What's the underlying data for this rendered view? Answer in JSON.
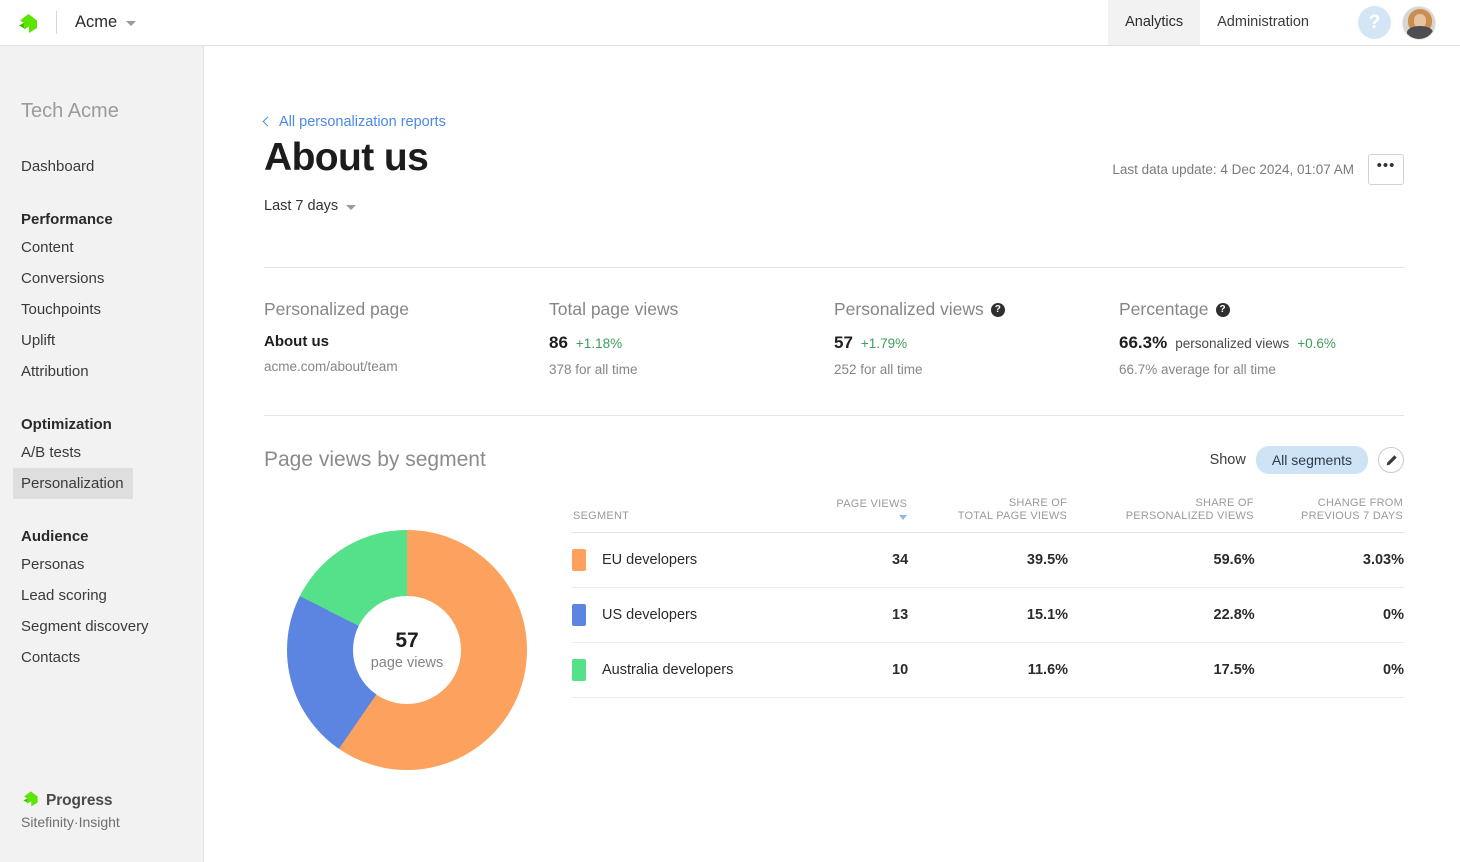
{
  "topbar": {
    "logo_icon": "progress-logo-icon",
    "org_name": "Acme",
    "org_caret_icon": "chevron-down-icon",
    "tabs": [
      {
        "label": "Analytics",
        "active": true
      },
      {
        "label": "Administration",
        "active": false
      }
    ],
    "help_icon": "question-mark-icon",
    "help_glyph": "?",
    "avatar_icon": "user-avatar"
  },
  "sidebar": {
    "org_title": "Tech Acme",
    "items": [
      {
        "label": "Dashboard",
        "type": "link",
        "selected": false
      },
      {
        "label": "Performance",
        "type": "group"
      },
      {
        "label": "Content",
        "type": "link",
        "selected": false
      },
      {
        "label": "Conversions",
        "type": "link",
        "selected": false
      },
      {
        "label": "Touchpoints",
        "type": "link",
        "selected": false
      },
      {
        "label": "Uplift",
        "type": "link",
        "selected": false
      },
      {
        "label": "Attribution",
        "type": "link",
        "selected": false
      },
      {
        "label": "Optimization",
        "type": "group"
      },
      {
        "label": "A/B tests",
        "type": "link",
        "selected": false
      },
      {
        "label": "Personalization",
        "type": "link",
        "selected": true
      },
      {
        "label": "Audience",
        "type": "group"
      },
      {
        "label": "Personas",
        "type": "link",
        "selected": false
      },
      {
        "label": "Lead scoring",
        "type": "link",
        "selected": false
      },
      {
        "label": "Segment discovery",
        "type": "link",
        "selected": false
      },
      {
        "label": "Contacts",
        "type": "link",
        "selected": false
      }
    ],
    "footer": {
      "logo_icon": "progress-logo-icon",
      "product_name": "Progress",
      "product_sub": "Sitefinity·Insight"
    }
  },
  "header": {
    "breadcrumb_icon": "chevron-left-icon",
    "breadcrumb_label": "All personalization reports",
    "title": "About us",
    "date_range": "Last 7 days",
    "date_range_icon": "chevron-down-icon",
    "last_update": "Last data update: 4 Dec 2024, 01:07 AM",
    "more_icon": "ellipsis-icon",
    "more_glyph": "•••"
  },
  "kpis": [
    {
      "label": "Personalized page",
      "has_info": false,
      "value": "About us",
      "value_style": "strong",
      "delta": "",
      "inline_note": "",
      "sub": "acme.com/about/team"
    },
    {
      "label": "Total page views",
      "has_info": false,
      "value": "86",
      "value_style": "number",
      "delta": "+1.18%",
      "inline_note": "",
      "sub": "378 for all time"
    },
    {
      "label": "Personalized views",
      "has_info": true,
      "info_glyph": "?",
      "value": "57",
      "value_style": "number",
      "delta": "+1.79%",
      "inline_note": "",
      "sub": "252 for all time"
    },
    {
      "label": "Percentage",
      "has_info": true,
      "info_glyph": "?",
      "value": "66.3%",
      "value_style": "number",
      "delta": "+0.6%",
      "inline_note": "personalized views",
      "sub": "66.7% average for all time"
    }
  ],
  "segment_section": {
    "title": "Page views by segment",
    "show_label": "Show",
    "filter_pill": "All segments",
    "edit_icon": "pencil-icon",
    "columns": [
      {
        "key": "segment",
        "line1": "",
        "line2": "SEGMENT",
        "align": "left",
        "sorted": false
      },
      {
        "key": "page_views",
        "line1": "",
        "line2": "PAGE VIEWS",
        "align": "right",
        "sorted": true,
        "sort_icon": "sort-desc-icon"
      },
      {
        "key": "share_total",
        "line1": "SHARE OF",
        "line2": "TOTAL PAGE VIEWS",
        "align": "right",
        "sorted": false
      },
      {
        "key": "share_personalized",
        "line1": "SHARE OF",
        "line2": "PERSONALIZED VIEWS",
        "align": "right",
        "sorted": false
      },
      {
        "key": "change",
        "line1": "CHANGE FROM",
        "line2": "PREVIOUS 7 DAYS",
        "align": "right",
        "sorted": false
      }
    ],
    "rows": [
      {
        "color": "#FCA25E",
        "segment": "EU developers",
        "page_views": "34",
        "share_total": "39.5%",
        "share_personalized": "59.6%",
        "change": "3.03%",
        "change_positive": true
      },
      {
        "color": "#5B85E0",
        "segment": "US developers",
        "page_views": "13",
        "share_total": "15.1%",
        "share_personalized": "22.8%",
        "change": "0%",
        "change_positive": false
      },
      {
        "color": "#55E08A",
        "segment": "Australia developers",
        "page_views": "10",
        "share_total": "11.6%",
        "share_personalized": "17.5%",
        "change": "0%",
        "change_positive": false
      }
    ]
  },
  "chart_data": {
    "type": "pie",
    "variant": "donut",
    "title": "Page views by segment",
    "center_value": "57",
    "center_caption": "page views",
    "labels": [
      "EU developers",
      "US developers",
      "Australia developers"
    ],
    "values": [
      34,
      13,
      10
    ],
    "percentages": [
      59.6,
      22.8,
      17.5
    ],
    "colors": [
      "#FCA25E",
      "#5B85E0",
      "#55E08A"
    ],
    "start_angle_deg": 0,
    "direction": "clockwise",
    "inner_radius_ratio": 0.45,
    "legend": "table-right"
  },
  "palette": {
    "accent_blue": "#4a89e8",
    "positive_green": "#3f9e5b",
    "brand_green": "#5CE500",
    "sidebar_bg": "#f2f2f2",
    "pill_bg": "#cfe3f7"
  }
}
